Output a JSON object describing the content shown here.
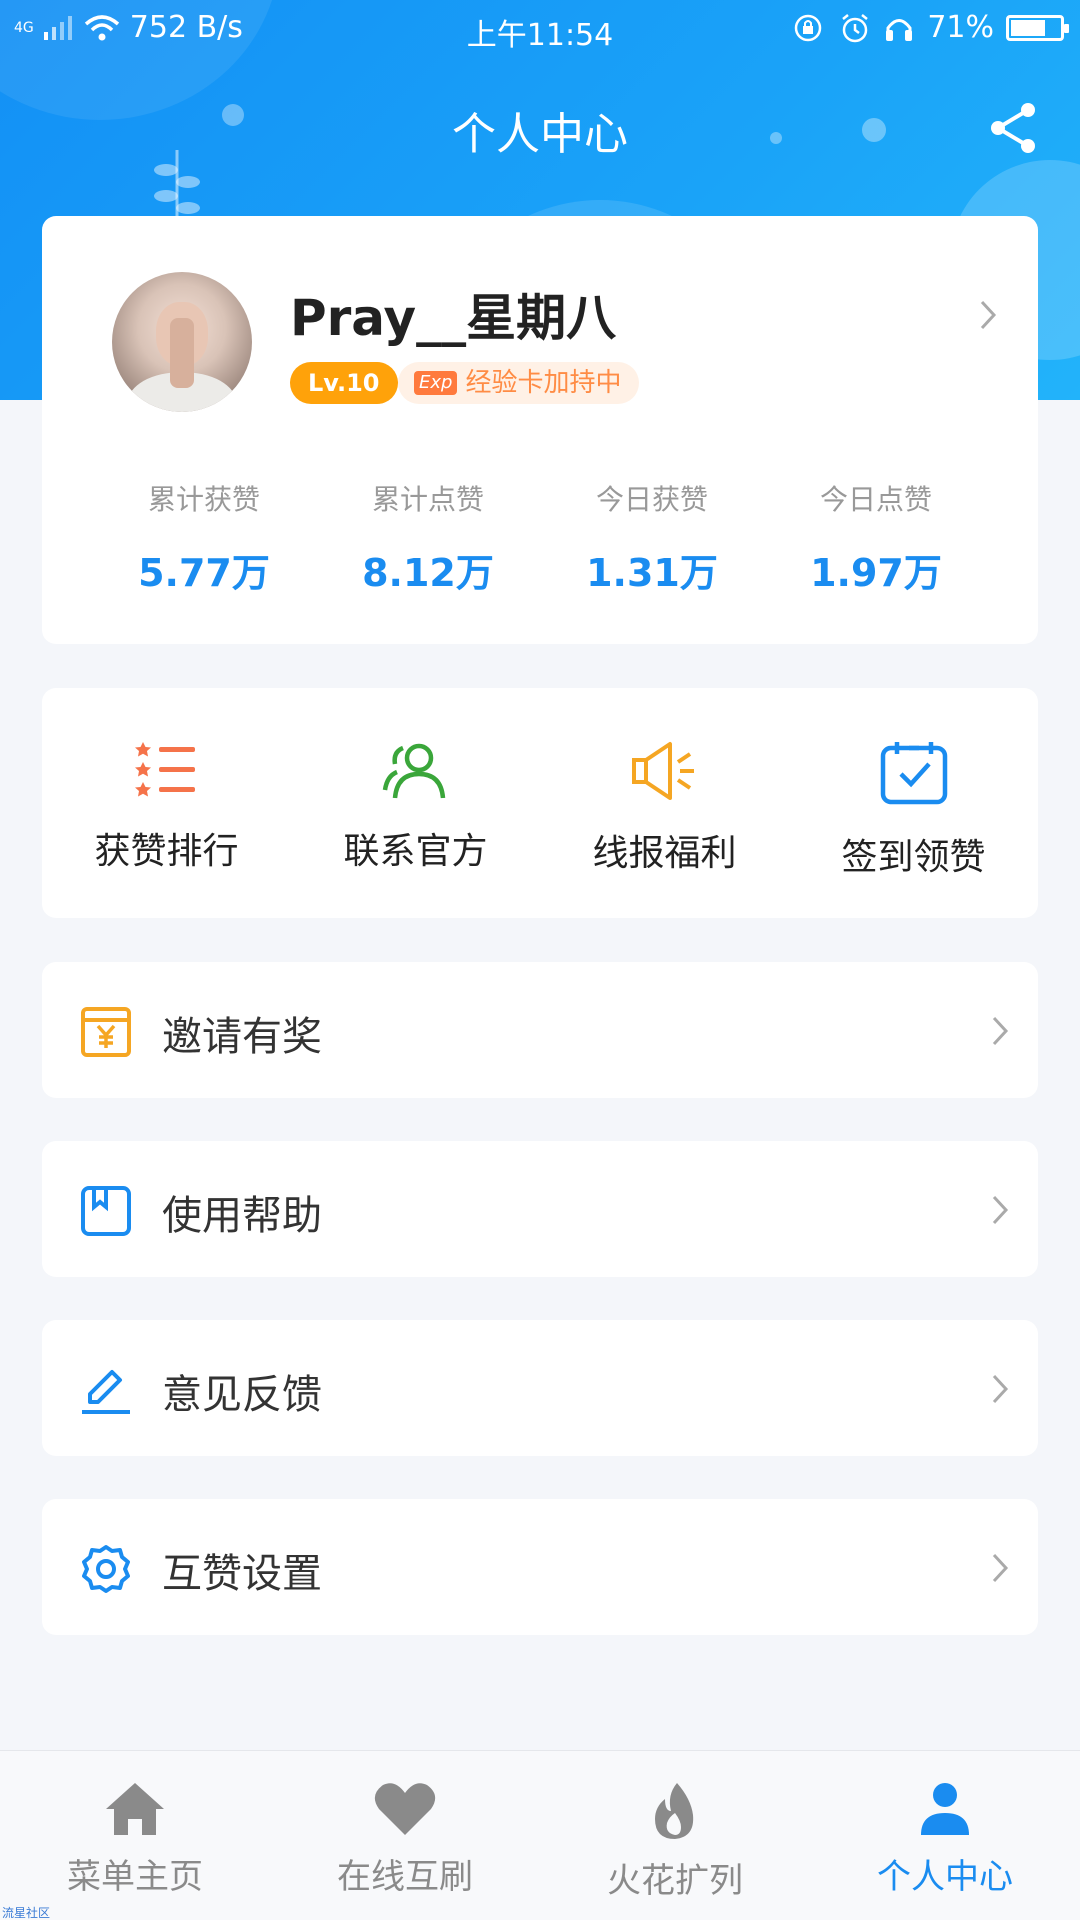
{
  "status_bar": {
    "network": "4G",
    "speed": "752 B/s",
    "time": "上午11:54",
    "battery": "71%",
    "battery_level": 0.71
  },
  "header": {
    "title": "个人中心"
  },
  "profile": {
    "username": "Pray__星期八",
    "level": "Lv.10",
    "exp_icon": "Exp",
    "exp_text": "经验卡加持中",
    "stats": [
      {
        "label": "累计获赞",
        "value": "5.77万"
      },
      {
        "label": "累计点赞",
        "value": "8.12万"
      },
      {
        "label": "今日获赞",
        "value": "1.31万"
      },
      {
        "label": "今日点赞",
        "value": "1.97万"
      }
    ]
  },
  "quick_actions": [
    {
      "label": "获赞排行",
      "icon": "ranking-list-icon",
      "color": "#f5734a"
    },
    {
      "label": "联系官方",
      "icon": "contact-people-icon",
      "color": "#3aa63a"
    },
    {
      "label": "线报福利",
      "icon": "megaphone-icon",
      "color": "#f5a623"
    },
    {
      "label": "签到领赞",
      "icon": "calendar-check-icon",
      "color": "#1a8cf0"
    }
  ],
  "menu": [
    {
      "label": "邀请有奖",
      "icon": "yuan-coupon-icon",
      "color": "#f5a623"
    },
    {
      "label": "使用帮助",
      "icon": "bookmark-book-icon",
      "color": "#1a8cf0"
    },
    {
      "label": "意见反馈",
      "icon": "pencil-edit-icon",
      "color": "#1a8cf0"
    },
    {
      "label": "互赞设置",
      "icon": "gear-icon",
      "color": "#1a8cf0"
    }
  ],
  "bottom_nav": [
    {
      "label": "菜单主页",
      "icon": "home-icon",
      "active": false
    },
    {
      "label": "在线互刷",
      "icon": "heart-icon",
      "active": false
    },
    {
      "label": "火花扩列",
      "icon": "flame-icon",
      "active": false
    },
    {
      "label": "个人中心",
      "icon": "person-icon",
      "active": true
    }
  ],
  "watermark": "流星社区",
  "colors": {
    "primary": "#1a8cf0",
    "header": "#1aa3f8",
    "level_badge": "#ffa20a"
  }
}
